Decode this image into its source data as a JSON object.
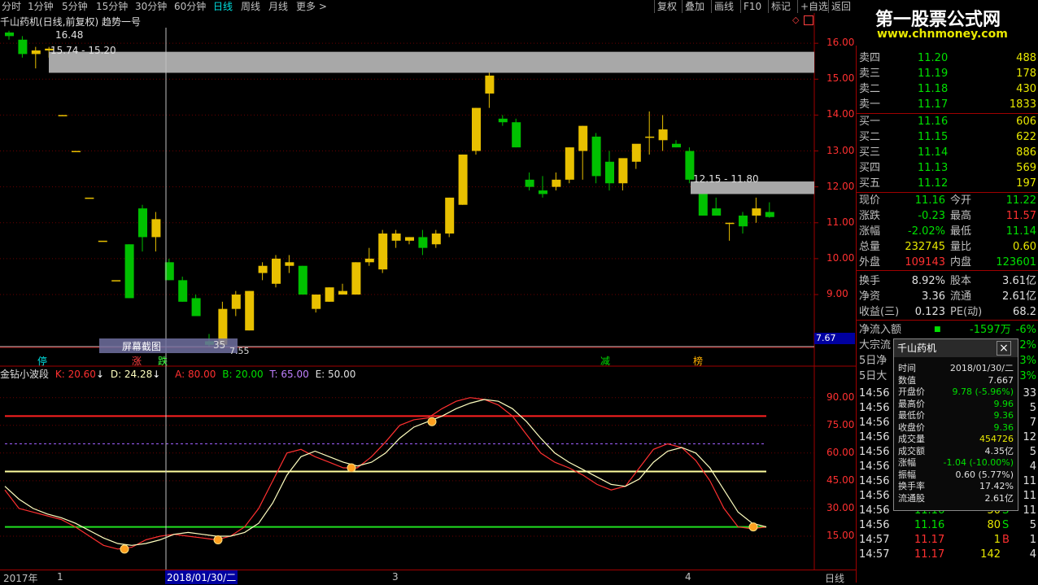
{
  "tabs": [
    {
      "label": "分时"
    },
    {
      "label": "1分钟"
    },
    {
      "label": "5分钟"
    },
    {
      "label": "15分钟"
    },
    {
      "label": "30分钟"
    },
    {
      "label": "60分钟"
    },
    {
      "label": "日线"
    },
    {
      "label": "周线"
    },
    {
      "label": "月线"
    },
    {
      "label": "更多 >"
    }
  ],
  "active_tab": "日线",
  "toolbar": [
    "复权",
    "叠加",
    "画线",
    "F10",
    "标记",
    "+自选",
    "返回"
  ],
  "stock_title": "千山药机(日线,前复权) 趋势一号",
  "price_axis": [
    "16.00",
    "15.00",
    "14.00",
    "13.00",
    "12.00",
    "11.00",
    "10.00",
    "9.00",
    "7.67"
  ],
  "annotations": {
    "top_high": "16.48",
    "top_range": "15.74 - 15.20",
    "right_range": "12.15 - 11.80",
    "low_label": "7.55",
    "screenshot_btn": "屏幕截图",
    "low_num": "35"
  },
  "markers": [
    {
      "text": "停",
      "color": "#00e0e0"
    },
    {
      "text": "涨",
      "color": "#ff4040"
    },
    {
      "text": "跌",
      "color": "#40ff40"
    },
    {
      "text": "减",
      "color": "#00e000"
    },
    {
      "text": "榜",
      "color": "#ffb000"
    }
  ],
  "indicator": {
    "name": "金钻小波段",
    "K": "K: 20.60",
    "D": "D: 24.28",
    "A": "A: 80.00",
    "B": "B: 20.00",
    "T": "T: 65.00",
    "E": "E: 50.00",
    "axis": [
      "90.00",
      "75.00",
      "60.00",
      "45.00",
      "30.00",
      "15.00"
    ]
  },
  "date_axis": {
    "year": "2017年",
    "t1": "1",
    "cursor": "2018/01/30/二",
    "t3": "3",
    "t4": "4",
    "period": "日线"
  },
  "logo": {
    "title": "第一股票公式网",
    "url": "www.chnmoney.com"
  },
  "quotes": {
    "sell": [
      {
        "label": "卖四",
        "price": "11.20",
        "vol": "488"
      },
      {
        "label": "卖三",
        "price": "11.19",
        "vol": "178"
      },
      {
        "label": "卖二",
        "price": "11.18",
        "vol": "430"
      },
      {
        "label": "卖一",
        "price": "11.17",
        "vol": "1833"
      }
    ],
    "buy": [
      {
        "label": "买一",
        "price": "11.16",
        "vol": "606"
      },
      {
        "label": "买二",
        "price": "11.15",
        "vol": "622"
      },
      {
        "label": "买三",
        "price": "11.14",
        "vol": "886"
      },
      {
        "label": "买四",
        "price": "11.13",
        "vol": "569"
      },
      {
        "label": "买五",
        "price": "11.12",
        "vol": "197"
      }
    ]
  },
  "stats": [
    {
      "l1": "现价",
      "v1": "11.16",
      "c1": "grn",
      "l2": "今开",
      "v2": "11.22",
      "c2": "grn"
    },
    {
      "l1": "涨跌",
      "v1": "-0.23",
      "c1": "grn",
      "l2": "最高",
      "v2": "11.57",
      "c2": "red"
    },
    {
      "l1": "涨幅",
      "v1": "-2.02%",
      "c1": "grn",
      "l2": "最低",
      "v2": "11.14",
      "c2": "grn"
    },
    {
      "l1": "总量",
      "v1": "232745",
      "c1": "ylw",
      "l2": "量比",
      "v2": "0.60",
      "c2": "ylw"
    },
    {
      "l1": "外盘",
      "v1": "109143",
      "c1": "red",
      "l2": "内盘",
      "v2": "123601",
      "c2": "grn"
    },
    {
      "l1": "换手",
      "v1": "8.92%",
      "c1": "wht",
      "l2": "股本",
      "v2": "3.61亿",
      "c2": "wht"
    },
    {
      "l1": "净资",
      "v1": "3.36",
      "c1": "wht",
      "l2": "流通",
      "v2": "2.61亿",
      "c2": "wht"
    },
    {
      "l1": "收益(三)",
      "v1": "0.123",
      "c1": "wht",
      "l2": "PE(动)",
      "v2": "68.2",
      "c2": "wht"
    }
  ],
  "flow": [
    {
      "label": "净流入额",
      "value": "-1597万",
      "pct": "-6%"
    },
    {
      "label": "大宗流",
      "value": "",
      "pct": "2%"
    },
    {
      "label": "5日净",
      "value": "",
      "pct": "3%"
    },
    {
      "label": "5日大",
      "value": "",
      "pct": "3%"
    }
  ],
  "ticks": [
    {
      "t": "14:56",
      "p": "",
      "v": "",
      "f": "",
      "n": "33"
    },
    {
      "t": "14:56",
      "p": "",
      "v": "",
      "f": "",
      "n": "5"
    },
    {
      "t": "14:56",
      "p": "",
      "v": "",
      "f": "",
      "n": "7"
    },
    {
      "t": "14:56",
      "p": "",
      "v": "",
      "f": "",
      "n": "12"
    },
    {
      "t": "14:56",
      "p": "",
      "v": "",
      "f": "",
      "n": "5"
    },
    {
      "t": "14:56",
      "p": "",
      "v": "",
      "f": "",
      "n": "4"
    },
    {
      "t": "14:56",
      "p": "",
      "v": "",
      "f": "",
      "n": "11"
    },
    {
      "t": "14:56",
      "p": "",
      "v": "",
      "f": "",
      "n": "11"
    },
    {
      "t": "14:56",
      "p": "11.16",
      "v": "50",
      "f": "S",
      "n": "11"
    },
    {
      "t": "14:56",
      "p": "11.16",
      "v": "80",
      "f": "S",
      "n": "5"
    },
    {
      "t": "14:57",
      "p": "11.17",
      "v": "1",
      "f": "B",
      "n": "1"
    },
    {
      "t": "14:57",
      "p": "11.17",
      "v": "142",
      "f": "",
      "n": "4"
    }
  ],
  "popup": {
    "title": "千山药机",
    "close": "×",
    "rows": [
      {
        "k": "时间",
        "v": "2018/01/30/二",
        "c": "#e0e0e0"
      },
      {
        "k": "数值",
        "v": "7.667",
        "c": "#e0e0e0"
      },
      {
        "k": "开盘价",
        "v": "9.78 (-5.96%)",
        "c": "#00e000"
      },
      {
        "k": "最高价",
        "v": "9.96",
        "c": "#00e000"
      },
      {
        "k": "最低价",
        "v": "9.36",
        "c": "#00e000"
      },
      {
        "k": "收盘价",
        "v": "9.36",
        "c": "#00e000"
      },
      {
        "k": "成交量",
        "v": "454726",
        "c": "#e8e800"
      },
      {
        "k": "成交额",
        "v": "4.35亿",
        "c": "#e0e0e0"
      },
      {
        "k": "涨幅",
        "v": "-1.04 (-10.00%)",
        "c": "#00e000"
      },
      {
        "k": "振幅",
        "v": "0.60 (5.77%)",
        "c": "#e0e0e0"
      },
      {
        "k": "换手率",
        "v": "17.42%",
        "c": "#e0e0e0"
      },
      {
        "k": "流通股",
        "v": "2.61亿",
        "c": "#e0e0e0"
      }
    ]
  },
  "colors": {
    "up": "#e8c000",
    "down": "#00c000",
    "axis": "#a00000",
    "bg": "#000000",
    "k_line": "#ff3030",
    "d_line": "#ffffc0"
  },
  "chart_data": {
    "type": "candlestick",
    "candles": [
      [
        16.3,
        16.35,
        16.1,
        16.2
      ],
      [
        16.1,
        16.2,
        15.6,
        15.7
      ],
      [
        15.7,
        15.9,
        15.3,
        15.8
      ],
      [
        15.8,
        15.9,
        15.6,
        15.85
      ],
      [
        14.0,
        14.0,
        14.0,
        14.0
      ],
      [
        13.0,
        13.0,
        13.0,
        13.0
      ],
      [
        11.7,
        11.7,
        11.7,
        11.7
      ],
      [
        10.5,
        10.5,
        10.5,
        10.5
      ],
      [
        9.4,
        9.4,
        9.4,
        9.4
      ],
      [
        10.4,
        10.4,
        8.9,
        8.9
      ],
      [
        11.4,
        11.5,
        10.2,
        10.6
      ],
      [
        10.6,
        11.3,
        10.2,
        11.1
      ],
      [
        9.9,
        10.0,
        9.4,
        9.4
      ],
      [
        9.4,
        9.5,
        8.8,
        8.8
      ],
      [
        8.9,
        9.0,
        8.4,
        8.4
      ],
      [
        7.7,
        7.9,
        7.55,
        7.6
      ],
      [
        7.6,
        8.8,
        7.55,
        8.6
      ],
      [
        8.6,
        9.1,
        8.4,
        9.0
      ],
      [
        8.0,
        9.1,
        8.0,
        9.1
      ],
      [
        9.6,
        9.9,
        9.4,
        9.8
      ],
      [
        9.3,
        10.1,
        9.2,
        10.0
      ],
      [
        9.8,
        10.1,
        9.6,
        9.9
      ],
      [
        9.8,
        9.8,
        9.0,
        9.0
      ],
      [
        8.6,
        9.0,
        8.5,
        9.0
      ],
      [
        8.8,
        9.2,
        8.8,
        9.2
      ],
      [
        9.0,
        9.3,
        9.0,
        9.1
      ],
      [
        9.0,
        9.9,
        9.0,
        9.9
      ],
      [
        9.9,
        10.3,
        9.8,
        10.0
      ],
      [
        9.7,
        10.8,
        9.6,
        10.7
      ],
      [
        10.5,
        10.8,
        10.3,
        10.7
      ],
      [
        10.5,
        10.6,
        10.4,
        10.6
      ],
      [
        10.6,
        10.8,
        10.1,
        10.3
      ],
      [
        10.4,
        10.8,
        10.3,
        10.7
      ],
      [
        10.7,
        11.7,
        10.6,
        11.7
      ],
      [
        11.5,
        12.9,
        11.5,
        12.9
      ],
      [
        13.0,
        14.2,
        12.9,
        14.2
      ],
      [
        14.6,
        15.2,
        14.2,
        15.1
      ],
      [
        13.9,
        14.0,
        13.7,
        13.8
      ],
      [
        13.8,
        13.9,
        13.1,
        13.1
      ],
      [
        12.2,
        12.4,
        11.9,
        12.0
      ],
      [
        11.9,
        12.3,
        11.7,
        11.8
      ],
      [
        12.0,
        12.4,
        11.9,
        12.2
      ],
      [
        12.2,
        13.1,
        12.1,
        13.1
      ],
      [
        13.0,
        13.7,
        12.2,
        13.7
      ],
      [
        13.4,
        13.5,
        12.1,
        12.3
      ],
      [
        12.7,
        13.0,
        11.9,
        12.1
      ],
      [
        12.1,
        12.7,
        11.9,
        12.8
      ],
      [
        12.7,
        13.1,
        12.5,
        13.2
      ],
      [
        13.4,
        14.1,
        12.9,
        13.4
      ],
      [
        13.3,
        14.0,
        13.0,
        13.6
      ],
      [
        13.2,
        13.3,
        13.1,
        13.1
      ],
      [
        13.0,
        13.1,
        12.1,
        12.2
      ],
      [
        11.9,
        11.9,
        11.2,
        11.2
      ],
      [
        11.4,
        11.7,
        11.2,
        11.2
      ],
      [
        11.0,
        11.0,
        10.5,
        11.0
      ],
      [
        11.2,
        11.3,
        10.7,
        10.9
      ],
      [
        11.2,
        11.7,
        11.0,
        11.4
      ],
      [
        11.3,
        11.57,
        11.14,
        11.16
      ]
    ],
    "k_line": [
      40,
      30,
      28,
      26,
      24,
      20,
      15,
      10,
      8,
      9,
      13,
      15,
      16,
      15,
      14,
      13,
      15,
      20,
      30,
      45,
      60,
      62,
      58,
      55,
      52,
      52,
      58,
      66,
      75,
      78,
      79,
      84,
      88,
      90,
      89,
      86,
      80,
      70,
      60,
      55,
      52,
      48,
      43,
      40,
      42,
      52,
      62,
      65,
      63,
      56,
      45,
      30,
      20,
      19,
      20
    ],
    "d_line": [
      42,
      35,
      30,
      27,
      25,
      22,
      18,
      14,
      11,
      10,
      11,
      13,
      16,
      17,
      16,
      15,
      15,
      17,
      22,
      33,
      48,
      58,
      61,
      58,
      55,
      53,
      55,
      60,
      68,
      74,
      77,
      80,
      84,
      87,
      89,
      88,
      84,
      77,
      68,
      60,
      55,
      51,
      47,
      43,
      42,
      46,
      55,
      61,
      63,
      60,
      52,
      40,
      28,
      22,
      20
    ],
    "ylim": [
      7.55,
      16.48
    ],
    "ind_ylim": [
      0,
      100
    ]
  }
}
